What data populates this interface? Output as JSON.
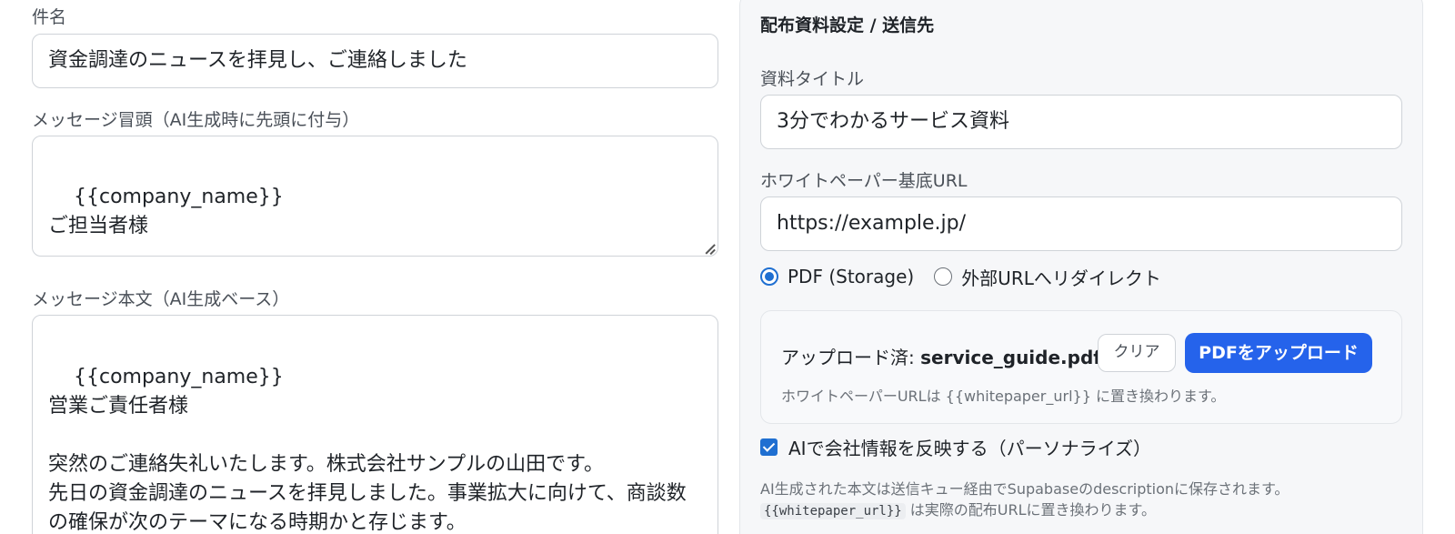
{
  "left": {
    "subject_label": "件名",
    "subject_value": "資金調達のニュースを拝見し、ご連絡しました",
    "intro_label": "メッセージ冒頭（AI生成時に先頭に付与）",
    "intro_value": "{{company_name}}\nご担当者様",
    "body_label": "メッセージ本文（AI生成ベース）",
    "body_value": "{{company_name}}\n営業ご責任者様\n\n突然のご連絡失礼いたします。株式会社サンプルの山田です。\n先日の資金調達のニュースを拝見しました。事業拡大に向けて、商談数\nの確保が次のテーマになる時期かと存じます。"
  },
  "right": {
    "title": "配布資料設定 / 送信先",
    "doc_title_label": "資料タイトル",
    "doc_title_value": "3分でわかるサービス資料",
    "base_url_label": "ホワイトペーパー基底URL",
    "base_url_value": "https://example.jp/",
    "radio_pdf": "PDF (Storage)",
    "radio_redirect": "外部URLへリダイレクト",
    "uploaded_prefix": "アップロード済: ",
    "uploaded_file": "service_guide.pdf",
    "clear_button": "クリア",
    "upload_button": "PDFをアップロード",
    "upload_help": "ホワイトペーパーURLは {{whitepaper_url}} に置き換わります。",
    "personalize_label": "AIで会社情報を反映する（パーソナライズ）",
    "note_line1": "AI生成された本文は送信キュー経由でSupabaseのdescriptionに保存されます。",
    "note_code": "{{whitepaper_url}}",
    "note_line2": " は実際の配布URLに置き換わります。"
  },
  "colors": {
    "accent": "#2563eb",
    "radio_checkbox": "#1f6fd1",
    "panel_bg": "#f6f7f9"
  }
}
